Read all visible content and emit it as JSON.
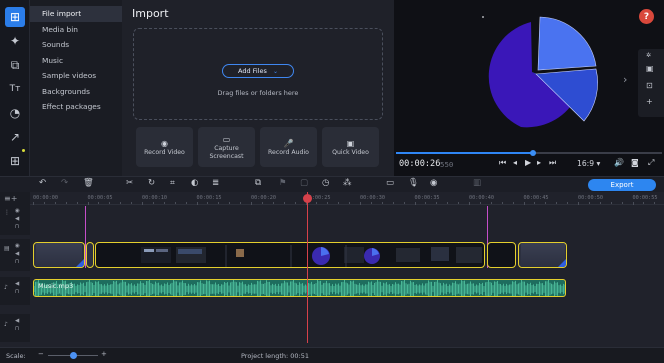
{
  "sidebar": {
    "icons": [
      "import-icon",
      "magic-wand-icon",
      "transitions-icon",
      "titles-icon",
      "stickers-icon",
      "callouts-icon",
      "more-tools-icon"
    ],
    "glyphs": [
      "⊞",
      "✦",
      "⧉",
      "Tт",
      "◔",
      "↗",
      "⊞"
    ]
  },
  "import_nav": {
    "items": [
      "File import",
      "Media bin",
      "Sounds",
      "Music",
      "Sample videos",
      "Backgrounds",
      "Effect packages"
    ],
    "active_index": 0
  },
  "import_panel": {
    "title": "Import",
    "add_files": "Add Files",
    "drag_text": "Drag files or folders here",
    "tiles": [
      {
        "name": "record-video",
        "label": "Record Video",
        "icon": "◉"
      },
      {
        "name": "capture-screencast",
        "label": "Capture Screencast",
        "icon": "▭"
      },
      {
        "name": "record-audio",
        "label": "Record Audio",
        "icon": "🎤"
      },
      {
        "name": "quick-video",
        "label": "Quick Video",
        "icon": "▣"
      }
    ]
  },
  "preview": {
    "help_label": "?",
    "time_current": "00:00:26",
    "time_frac": "550",
    "aspect_ratio": "16:9 ▾",
    "progress_fraction": 0.515,
    "colors": {
      "accent": "#2d86f0",
      "pie_dark": "#3a17b8",
      "pie_mid": "#2f4fd8",
      "pie_light": "#4a73f0"
    }
  },
  "toolbar": {
    "export_label": "Export"
  },
  "timeline": {
    "ruler_labels": [
      "00:00:00",
      "00:00:05",
      "00:00:10",
      "00:00:15",
      "00:00:20",
      "00:00:25",
      "00:00:30",
      "00:00:35",
      "00:00:40",
      "00:00:45",
      "00:00:50",
      "00:00:55"
    ],
    "audio_clip_label": "Music.mp3"
  },
  "status": {
    "scale_label": "Scale:",
    "project_length": "Project length:  00:51"
  }
}
